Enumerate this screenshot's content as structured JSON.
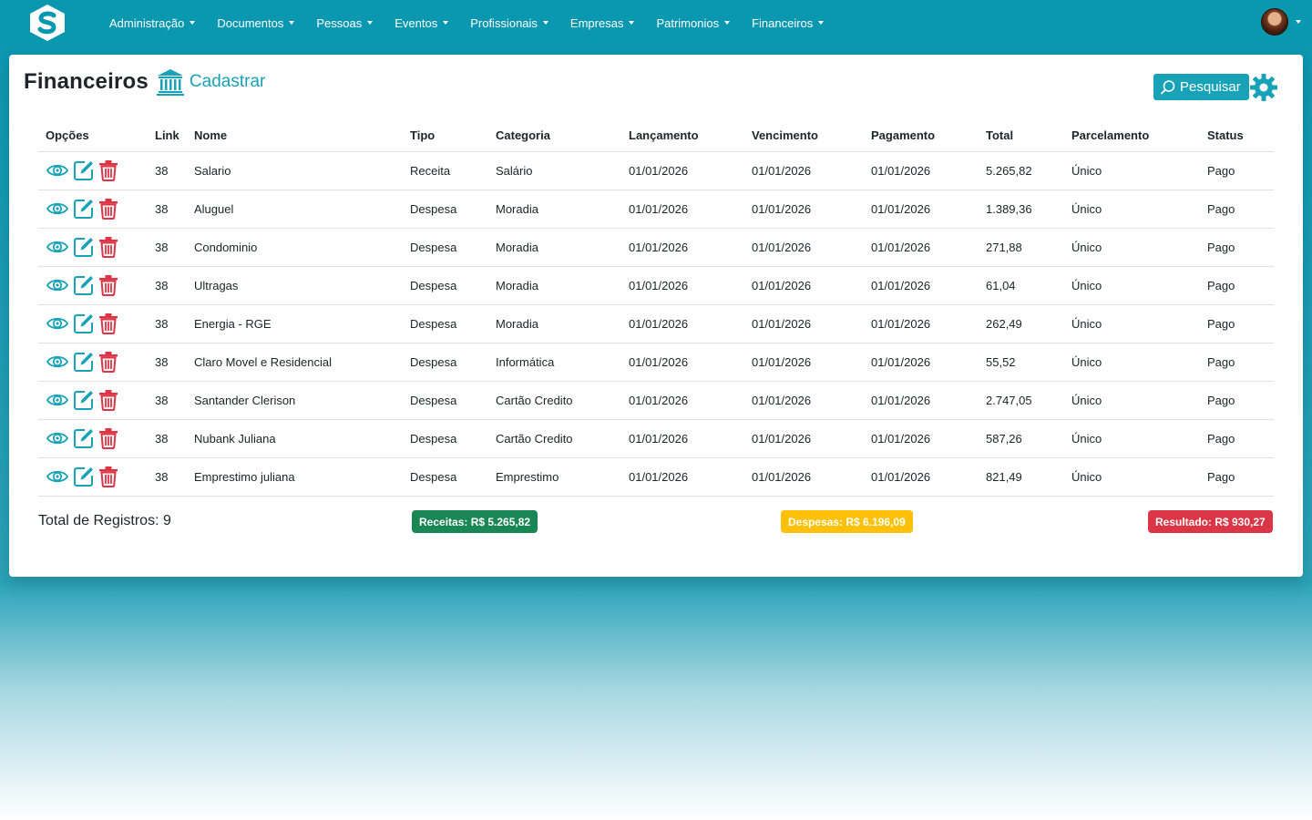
{
  "nav": {
    "items": [
      {
        "label": "Administração"
      },
      {
        "label": "Documentos"
      },
      {
        "label": "Pessoas"
      },
      {
        "label": "Eventos"
      },
      {
        "label": "Profissionais"
      },
      {
        "label": "Empresas"
      },
      {
        "label": "Patrimonios"
      },
      {
        "label": "Financeiros"
      }
    ]
  },
  "page": {
    "title": "Financeiros",
    "register_label": "Cadastrar",
    "search_label": "Pesquisar"
  },
  "table": {
    "columns": [
      "Opções",
      "Link",
      "Nome",
      "Tipo",
      "Categoria",
      "Lançamento",
      "Vencimento",
      "Pagamento",
      "Total",
      "Parcelamento",
      "Status"
    ],
    "rows": [
      {
        "link": "38",
        "nome": "Salario",
        "tipo": "Receita",
        "categoria": "Salário",
        "lancamento": "01/01/2026",
        "vencimento": "01/01/2026",
        "pagamento": "01/01/2026",
        "total": "5.265,82",
        "parcelamento": "Único",
        "status": "Pago"
      },
      {
        "link": "38",
        "nome": "Aluguel",
        "tipo": "Despesa",
        "categoria": "Moradia",
        "lancamento": "01/01/2026",
        "vencimento": "01/01/2026",
        "pagamento": "01/01/2026",
        "total": "1.389,36",
        "parcelamento": "Único",
        "status": "Pago"
      },
      {
        "link": "38",
        "nome": "Condominio",
        "tipo": "Despesa",
        "categoria": "Moradia",
        "lancamento": "01/01/2026",
        "vencimento": "01/01/2026",
        "pagamento": "01/01/2026",
        "total": "271,88",
        "parcelamento": "Único",
        "status": "Pago"
      },
      {
        "link": "38",
        "nome": "Ultragas",
        "tipo": "Despesa",
        "categoria": "Moradia",
        "lancamento": "01/01/2026",
        "vencimento": "01/01/2026",
        "pagamento": "01/01/2026",
        "total": "61,04",
        "parcelamento": "Único",
        "status": "Pago"
      },
      {
        "link": "38",
        "nome": "Energia - RGE",
        "tipo": "Despesa",
        "categoria": "Moradia",
        "lancamento": "01/01/2026",
        "vencimento": "01/01/2026",
        "pagamento": "01/01/2026",
        "total": "262,49",
        "parcelamento": "Único",
        "status": "Pago"
      },
      {
        "link": "38",
        "nome": "Claro Movel e Residencial",
        "tipo": "Despesa",
        "categoria": "Informática",
        "lancamento": "01/01/2026",
        "vencimento": "01/01/2026",
        "pagamento": "01/01/2026",
        "total": "55,52",
        "parcelamento": "Único",
        "status": "Pago"
      },
      {
        "link": "38",
        "nome": "Santander Clerison",
        "tipo": "Despesa",
        "categoria": "Cartão Credito",
        "lancamento": "01/01/2026",
        "vencimento": "01/01/2026",
        "pagamento": "01/01/2026",
        "total": "2.747,05",
        "parcelamento": "Único",
        "status": "Pago"
      },
      {
        "link": "38",
        "nome": "Nubank Juliana",
        "tipo": "Despesa",
        "categoria": "Cartão Credito",
        "lancamento": "01/01/2026",
        "vencimento": "01/01/2026",
        "pagamento": "01/01/2026",
        "total": "587,26",
        "parcelamento": "Único",
        "status": "Pago"
      },
      {
        "link": "38",
        "nome": "Emprestimo juliana",
        "tipo": "Despesa",
        "categoria": "Emprestimo",
        "lancamento": "01/01/2026",
        "vencimento": "01/01/2026",
        "pagamento": "01/01/2026",
        "total": "821,49",
        "parcelamento": "Único",
        "status": "Pago"
      }
    ]
  },
  "footer": {
    "total_registros": "Total de Registros: 9",
    "receitas": "Receitas: R$ 5.265,82",
    "despesas": "Despesas: R$ 6.196,09",
    "resultado": "Resultado: R$ 930,27"
  },
  "icons": {
    "logo": "s-logo-icon",
    "bank": "bank-icon",
    "search": "search-icon",
    "settings": "gear-icon",
    "view": "eye-icon",
    "edit": "edit-icon",
    "delete": "trash-icon"
  },
  "colors": {
    "navbar": "#0a97b0",
    "accent": "#17a2b8",
    "view_icon": "#17a2b8",
    "edit_icon": "#17a2b8",
    "delete_icon": "#dc3545",
    "receitas": "#198754",
    "despesas": "#ffc107",
    "resultado": "#dc3545"
  }
}
